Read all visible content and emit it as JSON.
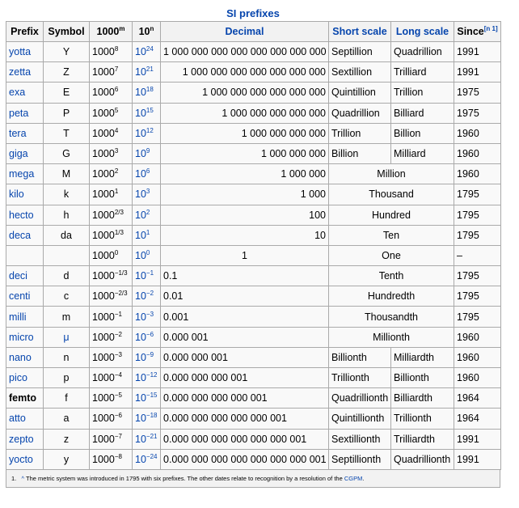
{
  "caption": "SI prefixes",
  "headers": {
    "prefix": "Prefix",
    "symbol": "Symbol",
    "thousand": "1000",
    "thousand_sup": "m",
    "ten": "10",
    "ten_sup": "n",
    "decimal": "Decimal",
    "short": "Short scale",
    "long": "Long scale",
    "since": "Since",
    "since_note": "[n 1]"
  },
  "rows": [
    {
      "prefix": "yotta",
      "symbol": "Y",
      "kb": "1000",
      "ke": "8",
      "tb": "10",
      "te": "24",
      "decimal": "1 000 000 000 000 000 000 000 000",
      "align": "r",
      "short": "Septillion",
      "long": "Quadrillion",
      "since": "1991"
    },
    {
      "prefix": "zetta",
      "symbol": "Z",
      "kb": "1000",
      "ke": "7",
      "tb": "10",
      "te": "21",
      "decimal": "1 000 000 000 000 000 000 000",
      "align": "r",
      "short": "Sextillion",
      "long": "Trilliard",
      "since": "1991"
    },
    {
      "prefix": "exa",
      "symbol": "E",
      "kb": "1000",
      "ke": "6",
      "tb": "10",
      "te": "18",
      "decimal": "1 000 000 000 000 000 000",
      "align": "r",
      "short": "Quintillion",
      "long": "Trillion",
      "since": "1975"
    },
    {
      "prefix": "peta",
      "symbol": "P",
      "kb": "1000",
      "ke": "5",
      "tb": "10",
      "te": "15",
      "decimal": "1 000 000 000 000 000",
      "align": "r",
      "short": "Quadrillion",
      "long": "Billiard",
      "since": "1975"
    },
    {
      "prefix": "tera",
      "symbol": "T",
      "kb": "1000",
      "ke": "4",
      "tb": "10",
      "te": "12",
      "decimal": "1 000 000 000 000",
      "align": "r",
      "short": "Trillion",
      "long": "Billion",
      "since": "1960"
    },
    {
      "prefix": "giga",
      "symbol": "G",
      "kb": "1000",
      "ke": "3",
      "tb": "10",
      "te": "9",
      "decimal": "1 000 000 000",
      "align": "r",
      "short": "Billion",
      "long": "Milliard",
      "since": "1960"
    },
    {
      "prefix": "mega",
      "symbol": "M",
      "kb": "1000",
      "ke": "2",
      "tb": "10",
      "te": "6",
      "decimal": "1 000 000",
      "align": "r",
      "merged": "Million",
      "since": "1960"
    },
    {
      "prefix": "kilo",
      "symbol": "k",
      "kb": "1000",
      "ke": "1",
      "tb": "10",
      "te": "3",
      "decimal": "1 000",
      "align": "r",
      "merged": "Thousand",
      "since": "1795"
    },
    {
      "prefix": "hecto",
      "symbol": "h",
      "kb": "1000",
      "ke": "2/3",
      "tb": "10",
      "te": "2",
      "decimal": "100",
      "align": "r",
      "merged": "Hundred",
      "since": "1795"
    },
    {
      "prefix": "deca",
      "symbol": "da",
      "kb": "1000",
      "ke": "1/3",
      "tb": "10",
      "te": "1",
      "decimal": "10",
      "align": "r",
      "merged": "Ten",
      "since": "1795"
    },
    {
      "prefix": "",
      "symbol": "",
      "kb": "1000",
      "ke": "0",
      "tb": "10",
      "te": "0",
      "decimal": "1",
      "align": "c",
      "merged": "One",
      "since": "–"
    },
    {
      "prefix": "deci",
      "symbol": "d",
      "kb": "1000",
      "ke": "−1/3",
      "tb": "10",
      "te": "−1",
      "decimal": "0.1",
      "align": "l",
      "merged": "Tenth",
      "since": "1795"
    },
    {
      "prefix": "centi",
      "symbol": "c",
      "kb": "1000",
      "ke": "−2/3",
      "tb": "10",
      "te": "−2",
      "decimal": "0.01",
      "align": "l",
      "merged": "Hundredth",
      "since": "1795"
    },
    {
      "prefix": "milli",
      "symbol": "m",
      "kb": "1000",
      "ke": "−1",
      "tb": "10",
      "te": "−3",
      "decimal": "0.001",
      "align": "l",
      "merged": "Thousandth",
      "since": "1795"
    },
    {
      "prefix": "micro",
      "symbol": "μ",
      "symbol_link": true,
      "kb": "1000",
      "ke": "−2",
      "tb": "10",
      "te": "−6",
      "decimal": "0.000 001",
      "align": "l",
      "merged": "Millionth",
      "since": "1960"
    },
    {
      "prefix": "nano",
      "symbol": "n",
      "kb": "1000",
      "ke": "−3",
      "tb": "10",
      "te": "−9",
      "decimal": "0.000 000 001",
      "align": "l",
      "short": "Billionth",
      "long": "Milliardth",
      "since": "1960"
    },
    {
      "prefix": "pico",
      "symbol": "p",
      "kb": "1000",
      "ke": "−4",
      "tb": "10",
      "te": "−12",
      "decimal": "0.000 000 000 001",
      "align": "l",
      "short": "Trillionth",
      "long": "Billionth",
      "since": "1960"
    },
    {
      "prefix": "femto",
      "symbol": "f",
      "bold": true,
      "kb": "1000",
      "ke": "−5",
      "tb": "10",
      "te": "−15",
      "decimal": "0.000 000 000 000 001",
      "align": "l",
      "short": "Quadrillionth",
      "long": "Billiardth",
      "since": "1964"
    },
    {
      "prefix": "atto",
      "symbol": "a",
      "kb": "1000",
      "ke": "−6",
      "tb": "10",
      "te": "−18",
      "decimal": "0.000 000 000 000 000 001",
      "align": "l",
      "short": "Quintillionth",
      "long": "Trillionth",
      "since": "1964"
    },
    {
      "prefix": "zepto",
      "symbol": "z",
      "kb": "1000",
      "ke": "−7",
      "tb": "10",
      "te": "−21",
      "decimal": "0.000 000 000 000 000 000 001",
      "align": "l",
      "short": "Sextillionth",
      "long": "Trilliardth",
      "since": "1991"
    },
    {
      "prefix": "yocto",
      "symbol": "y",
      "kb": "1000",
      "ke": "−8",
      "tb": "10",
      "te": "−24",
      "decimal": "0.000 000 000 000 000 000 000 001",
      "align": "l",
      "short": "Septillionth",
      "long": "Quadrillionth",
      "since": "1991"
    }
  ],
  "footnote": {
    "number": "1.",
    "caret": "^",
    "text": "The metric system was introduced in 1795 with six prefixes. The other dates relate to recognition by a resolution of the",
    "link": "CGPM",
    "end": "."
  },
  "colors": {
    "link": "#0645ad",
    "header_bg": "#f2f2f2",
    "cell_bg": "#f9f9f9",
    "border": "#aaaaaa"
  }
}
